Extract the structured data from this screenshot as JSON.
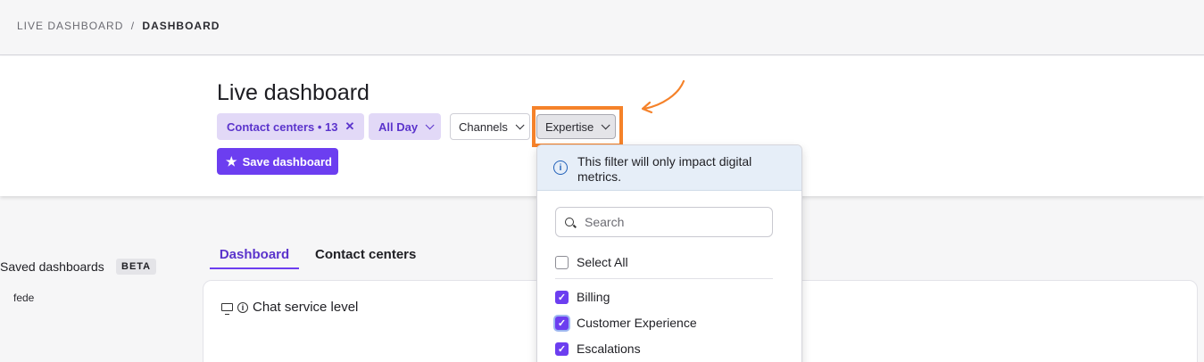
{
  "breadcrumb": {
    "parent": "LIVE DASHBOARD",
    "separator": "/",
    "current": "DASHBOARD"
  },
  "header": {
    "title": "Live dashboard"
  },
  "filters": {
    "contact_centers": "Contact centers • 13",
    "all_day": "All Day",
    "channels": "Channels",
    "expertise": "Expertise"
  },
  "save_button": "Save dashboard",
  "sidebar": {
    "title": "Saved dashboards",
    "badge": "BETA",
    "items": [
      "fede"
    ]
  },
  "tabs": [
    {
      "label": "Dashboard",
      "active": true
    },
    {
      "label": "Contact centers",
      "active": false
    }
  ],
  "card": {
    "title": "Chat service level"
  },
  "dropdown": {
    "notice": "This filter will only impact digital metrics.",
    "search_placeholder": "Search",
    "select_all": "Select All",
    "options": [
      {
        "label": "Billing",
        "checked": true
      },
      {
        "label": "Customer Experience",
        "checked": true
      },
      {
        "label": "Escalations",
        "checked": true
      }
    ]
  },
  "colors": {
    "accent": "#6c3ef0",
    "highlight": "#f5822a",
    "chip_bg": "#e2d9f7",
    "notice_bg": "#e6eef8"
  }
}
